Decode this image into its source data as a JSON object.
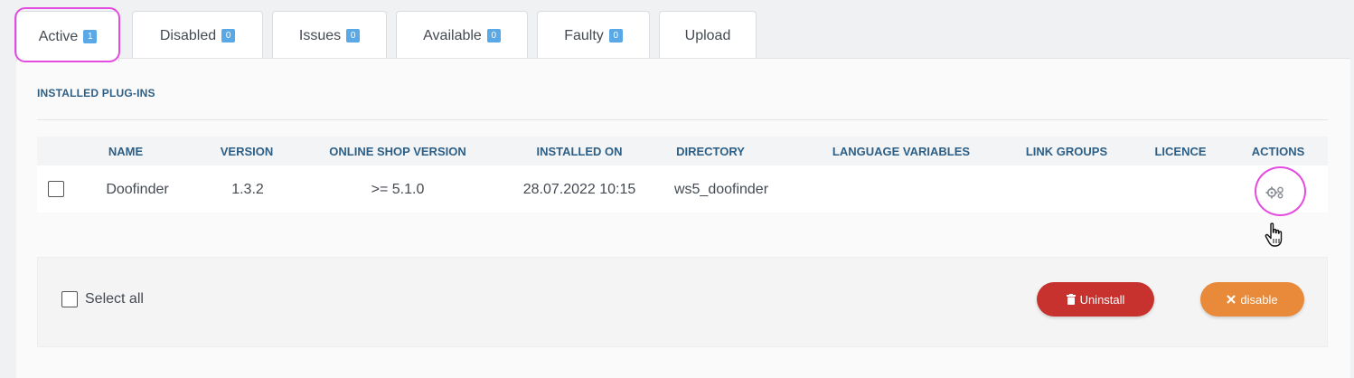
{
  "tabs": [
    {
      "label": "Active",
      "count": "1"
    },
    {
      "label": "Disabled",
      "count": "0"
    },
    {
      "label": "Issues",
      "count": "0"
    },
    {
      "label": "Available",
      "count": "0"
    },
    {
      "label": "Faulty",
      "count": "0"
    },
    {
      "label": "Upload"
    }
  ],
  "section_title": "INSTALLED PLUG-INS",
  "columns": [
    "NAME",
    "VERSION",
    "ONLINE SHOP VERSION",
    "INSTALLED ON",
    "DIRECTORY",
    "LANGUAGE VARIABLES",
    "LINK GROUPS",
    "LICENCE",
    "ACTIONS"
  ],
  "rows": [
    {
      "name": "Doofinder",
      "version": "1.3.2",
      "shop_version": ">= 5.1.0",
      "installed_on": "28.07.2022 10:15",
      "directory": "ws5_doofinder",
      "language_variables": "",
      "link_groups": "",
      "licence": "",
      "action_icon": "gears-icon"
    }
  ],
  "footer": {
    "select_all_label": "Select all",
    "uninstall_label": "Uninstall",
    "disable_label": "disable"
  },
  "colors": {
    "highlight": "#e44be0",
    "badge": "#5aa9e6",
    "heading": "#2d5f86",
    "uninstall": "#c8322e",
    "disable": "#e98a3a"
  }
}
